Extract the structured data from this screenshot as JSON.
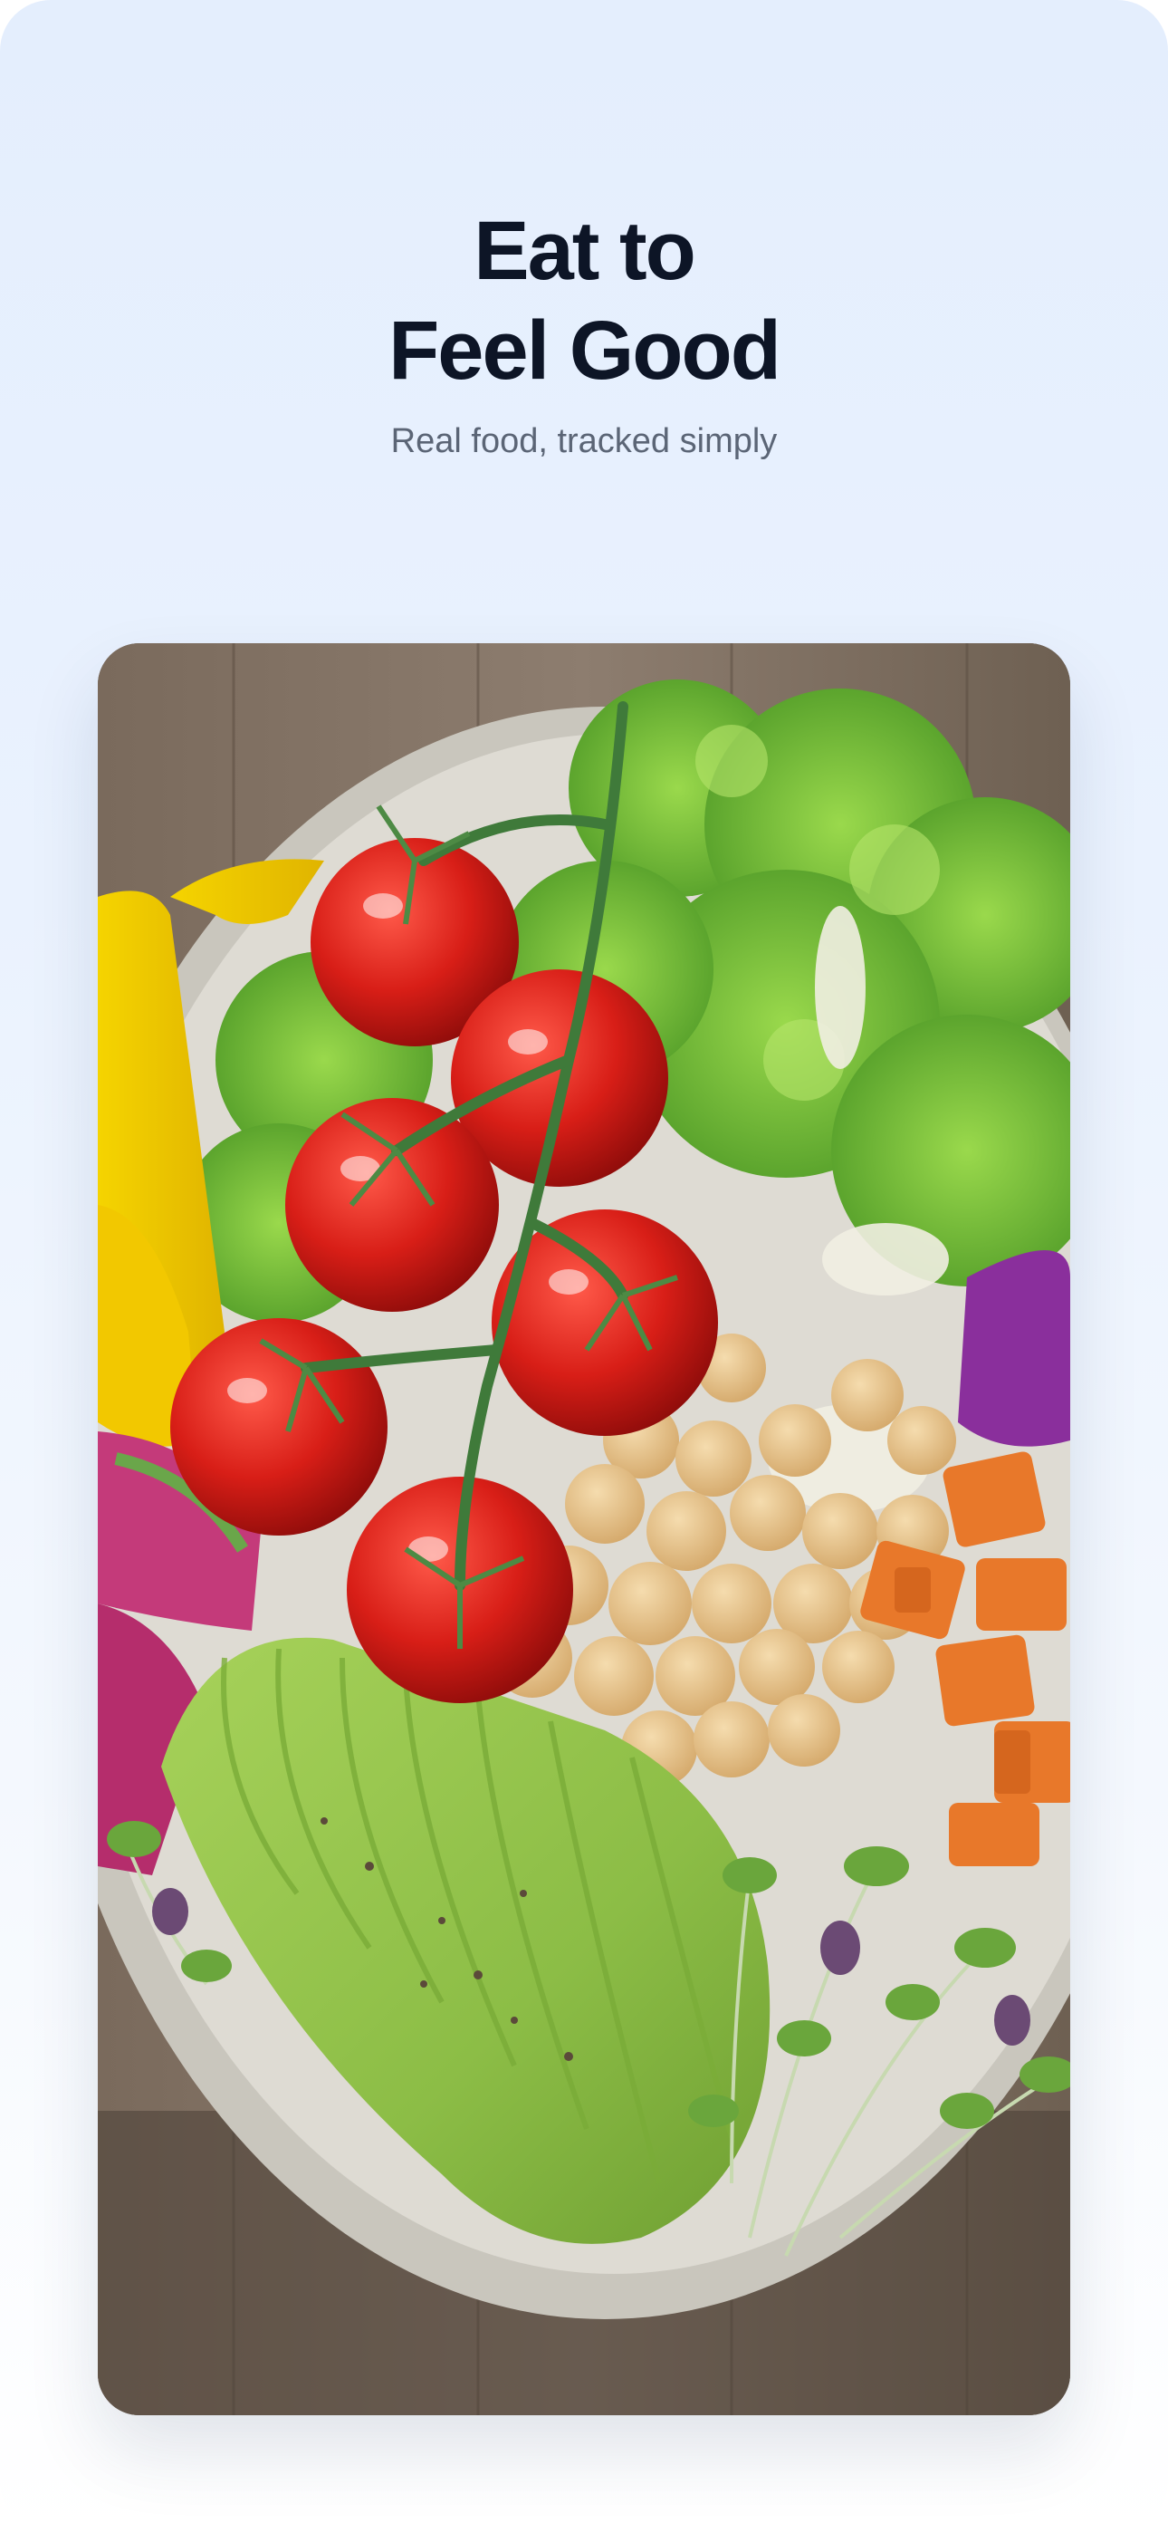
{
  "hero": {
    "title_line1": "Eat to",
    "title_line2": "Feel Good",
    "subtitle": "Real food, tracked simply"
  },
  "photo": {
    "subject": "salad bowl with tomatoes, lettuce, bell pepper, chickpeas, sweet potato, avocado, microgreens and radish"
  },
  "colors": {
    "title": "#0d1526",
    "subtitle": "#5b6576",
    "background_top": "#e4eefd",
    "background_bottom": "#ffffff"
  }
}
